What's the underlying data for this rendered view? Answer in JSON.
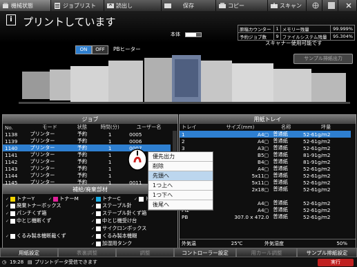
{
  "tabs": [
    {
      "label": "機械状態",
      "icon": "machine-status-icon"
    },
    {
      "label": "ジョブリスト",
      "icon": "job-list-icon"
    },
    {
      "label": "読出し",
      "icon": "recall-icon"
    },
    {
      "label": "保存",
      "icon": "save-icon"
    },
    {
      "label": "コピー",
      "icon": "copy-icon"
    },
    {
      "label": "スキャン",
      "icon": "scan-icon"
    }
  ],
  "status": {
    "title": "プリントしています",
    "honbody_label": "本体",
    "honbody_level": 0.7,
    "scanner_status": "スキャナー使用可能です"
  },
  "counters": [
    {
      "name": "原稿カウンター",
      "value": "1",
      "name2": "メモリー残量",
      "value2": "99.999%"
    },
    {
      "name": "予約ジョブ数",
      "value": "9",
      "name2": "ファイルシステム残量",
      "value2": "95.304%"
    }
  ],
  "sample_button": "サンプル排紙出力",
  "pb_heater": {
    "on": "ON",
    "off": "OFF",
    "label": "PBヒーター"
  },
  "jobs": {
    "title": "ジョブ",
    "columns": [
      "No.",
      "モード",
      "状態",
      "時間(分)",
      "ユーザー名"
    ],
    "rows": [
      [
        "1138",
        "プリンター",
        "予約",
        "1",
        "0005"
      ],
      [
        "1139",
        "プリンター",
        "予約",
        "1",
        "0006"
      ],
      [
        "1140",
        "プリンター",
        "予約",
        "1",
        "0007"
      ],
      [
        "1141",
        "プリンター",
        "予約",
        "1",
        ""
      ],
      [
        "1142",
        "プリンター",
        "予約",
        "1",
        ""
      ],
      [
        "1143",
        "プリンター",
        "予約",
        "1",
        ""
      ],
      [
        "1144",
        "プリンター",
        "予約",
        "1",
        ""
      ],
      [
        "1145",
        "プリンター",
        "予約",
        "1",
        "0011"
      ]
    ],
    "selected_index": 2
  },
  "context_menu": {
    "items": [
      "優先出力",
      "削除",
      "先頭へ",
      "1つ上へ",
      "1つ下へ",
      "後尾へ"
    ],
    "highlighted_index": 2
  },
  "paper": {
    "title": "用紙トレイ",
    "columns": [
      "トレイ",
      "サイズ(mm)",
      "名称",
      "坪量"
    ],
    "rows": [
      [
        "1",
        "A4▢",
        "普通紙",
        "52-61g/m2"
      ],
      [
        "2",
        "A4▢",
        "普通紙",
        "52-61g/m2"
      ],
      [
        "3",
        "A3▢",
        "普通紙",
        "52-61g/m2"
      ],
      [
        "4",
        "B5▢",
        "普通紙",
        "81-91g/m2"
      ],
      [
        "5",
        "B4▢",
        "普通紙",
        "81-91g/m2"
      ],
      [
        "6",
        "A4▢",
        "普通紙",
        "52-61g/m2"
      ],
      [
        "7",
        "5x11▢",
        "普通紙",
        "52-61g/m2"
      ],
      [
        "8",
        "5x11▢",
        "普通紙",
        "52-61g/m2"
      ],
      [
        "9",
        "2x18▢",
        "普通紙",
        "52-61g/m2"
      ],
      [
        "P1",
        "",
        "",
        ""
      ],
      [
        "P2",
        "A4▢",
        "普通紙",
        "52-61g/m2"
      ],
      [
        "PI2",
        "A4▢",
        "普通紙",
        "52-61g/m2"
      ],
      [
        "PB",
        "307.0 x 472.0",
        "普通紙",
        "52-61g/m2"
      ]
    ],
    "selected_index": 0,
    "outside_temp_label": "外気温",
    "outside_temp": "25℃",
    "humidity_label": "外気湿度",
    "humidity": "50%"
  },
  "supplies": {
    "title": "補給/廃棄部材",
    "items": [
      {
        "label": "トナーY",
        "color": "#f2d400"
      },
      {
        "label": "トナーM",
        "color": "#e0219a"
      },
      {
        "label": "トナーC",
        "color": "#19a9e0"
      },
      {
        "label": "トナーK",
        "color": "#ffffff"
      },
      {
        "label": "廃棄トナーボックス",
        "color": "#ffffff"
      },
      {
        "label": "ステープル針",
        "color": "#ffffff"
      },
      {
        "label": "パンチくず箱",
        "color": "#ffffff"
      },
      {
        "label": "ステープル針くず箱",
        "color": "#ffffff"
      },
      {
        "label": "中とじ機断くず",
        "color": "#ffffff"
      },
      {
        "label": "中とじ機受け台",
        "color": "#ffffff"
      },
      {
        "label": "サイクロンボックス",
        "color": "#ffffff"
      },
      {
        "label": "くるみ製本機断裁くず",
        "color": "#ffffff"
      },
      {
        "label": "くるみ製本機糊",
        "color": "#ffffff"
      },
      {
        "label": "加湿用タンク",
        "color": "#ffffff"
      }
    ]
  },
  "bottom_buttons": [
    {
      "label": "用紙設定",
      "enabled": true
    },
    {
      "label": "表裏調整",
      "enabled": false
    },
    {
      "label": "調整",
      "enabled": false
    },
    {
      "label": "コントローラー設定",
      "enabled": true
    },
    {
      "label": "用カール調整",
      "enabled": false
    },
    {
      "label": "サンプル排紙設定",
      "enabled": true
    }
  ],
  "footer": {
    "time": "19:28",
    "message": "プリントデータ受信できます",
    "right_label": "実行"
  },
  "colors": {
    "accent": "#2e7fd0",
    "toner_y": "#f2d400",
    "toner_m": "#e0219a",
    "toner_c": "#19a9e0",
    "footer_alert": "#c02020"
  }
}
